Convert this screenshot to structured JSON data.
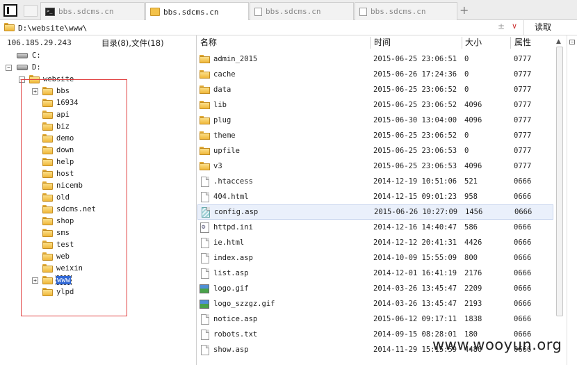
{
  "tabs": [
    {
      "label": "bbs.sdcms.cn",
      "icon": "terminal-icon",
      "active": false
    },
    {
      "label": "bbs.sdcms.cn",
      "icon": "folder-icon",
      "active": true
    },
    {
      "label": "bbs.sdcms.cn",
      "icon": "document-icon",
      "active": false
    },
    {
      "label": "bbs.sdcms.cn",
      "icon": "document-icon",
      "active": false
    }
  ],
  "new_tab": "+",
  "address": {
    "value": "D:\\website\\www\\",
    "go_label": "读取"
  },
  "server": {
    "ip": "106.185.29.243",
    "counts": "目录(8),文件(18)"
  },
  "tree": {
    "drives": [
      "C:",
      "D:"
    ],
    "root": "website",
    "folders": [
      "bbs",
      "16934",
      "api",
      "biz",
      "demo",
      "down",
      "help",
      "host",
      "nicemb",
      "old",
      "sdcms.net",
      "shop",
      "sms",
      "test",
      "web",
      "weixin",
      "www",
      "ylpd"
    ],
    "selected": "www"
  },
  "columns": {
    "name": "名称",
    "time": "时间",
    "size": "大小",
    "perm": "属性"
  },
  "files": [
    {
      "name": "admin_2015",
      "time": "2015-06-25 23:06:51",
      "size": "0",
      "perm": "0777",
      "type": "folder"
    },
    {
      "name": "cache",
      "time": "2015-06-26 17:24:36",
      "size": "0",
      "perm": "0777",
      "type": "folder"
    },
    {
      "name": "data",
      "time": "2015-06-25 23:06:52",
      "size": "0",
      "perm": "0777",
      "type": "folder"
    },
    {
      "name": "lib",
      "time": "2015-06-25 23:06:52",
      "size": "4096",
      "perm": "0777",
      "type": "folder"
    },
    {
      "name": "plug",
      "time": "2015-06-30 13:04:00",
      "size": "4096",
      "perm": "0777",
      "type": "folder"
    },
    {
      "name": "theme",
      "time": "2015-06-25 23:06:52",
      "size": "0",
      "perm": "0777",
      "type": "folder"
    },
    {
      "name": "upfile",
      "time": "2015-06-25 23:06:53",
      "size": "0",
      "perm": "0777",
      "type": "folder"
    },
    {
      "name": "v3",
      "time": "2015-06-25 23:06:53",
      "size": "4096",
      "perm": "0777",
      "type": "folder"
    },
    {
      "name": ".htaccess",
      "time": "2014-12-19 10:51:06",
      "size": "521",
      "perm": "0666",
      "type": "file"
    },
    {
      "name": "404.html",
      "time": "2014-12-15 09:01:23",
      "size": "958",
      "perm": "0666",
      "type": "file"
    },
    {
      "name": "config.asp",
      "time": "2015-06-26 10:27:09",
      "size": "1456",
      "perm": "0666",
      "type": "asp",
      "selected": true
    },
    {
      "name": "httpd.ini",
      "time": "2014-12-16 14:40:47",
      "size": "586",
      "perm": "0666",
      "type": "cfg"
    },
    {
      "name": "ie.html",
      "time": "2014-12-12 20:41:31",
      "size": "4426",
      "perm": "0666",
      "type": "file"
    },
    {
      "name": "index.asp",
      "time": "2014-10-09 15:55:09",
      "size": "800",
      "perm": "0666",
      "type": "file"
    },
    {
      "name": "list.asp",
      "time": "2014-12-01 16:41:19",
      "size": "2176",
      "perm": "0666",
      "type": "file"
    },
    {
      "name": "logo.gif",
      "time": "2014-03-26 13:45:47",
      "size": "2209",
      "perm": "0666",
      "type": "img"
    },
    {
      "name": "logo_szzgz.gif",
      "time": "2014-03-26 13:45:47",
      "size": "2193",
      "perm": "0666",
      "type": "img"
    },
    {
      "name": "notice.asp",
      "time": "2015-06-12 09:17:11",
      "size": "1838",
      "perm": "0666",
      "type": "file"
    },
    {
      "name": "robots.txt",
      "time": "2014-09-15 08:28:01",
      "size": "180",
      "perm": "0666",
      "type": "file"
    },
    {
      "name": "show.asp",
      "time": "2014-11-29 15:15:59",
      "size": "4480",
      "perm": "0666",
      "type": "file"
    }
  ],
  "watermark": "www.wooyun.org"
}
